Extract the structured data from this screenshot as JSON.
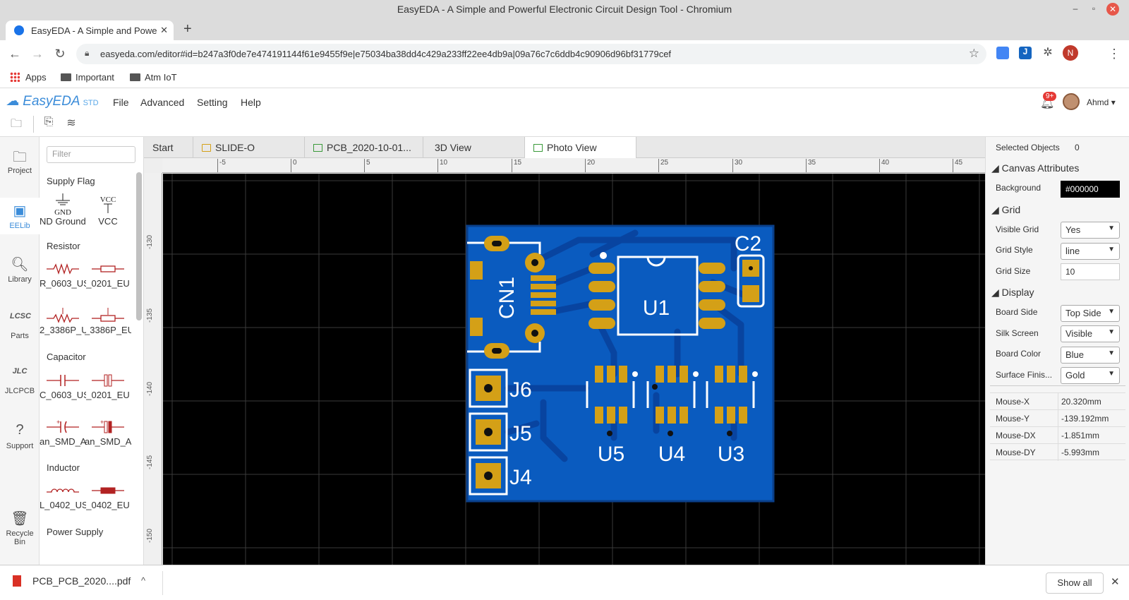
{
  "window": {
    "title": "EasyEDA - A Simple and Powerful Electronic Circuit Design Tool - Chromium"
  },
  "browser_tab": {
    "title": "EasyEDA - A Simple and Powe"
  },
  "address": {
    "url": "easyeda.com/editor#id=b247a3f0de7e474191144f61e9455f9e|e75034ba38dd4c429a233ff22ee4db9a|09a76c7c6ddb4c90906d96bf31779cef"
  },
  "profile_initial": "N",
  "bookmarks": [
    "Apps",
    "Important",
    "Atm IoT"
  ],
  "app": {
    "logo": "EasyEDA",
    "logo_suffix": "STD",
    "menu": [
      "File",
      "Advanced",
      "Setting",
      "Help"
    ],
    "notifications": "9+",
    "user": "Ahmd"
  },
  "leftbar": [
    "Project",
    "EELib",
    "Library",
    "Parts",
    "JLCPCB",
    "Support",
    "Recycle Bin"
  ],
  "library": {
    "filter_placeholder": "Filter",
    "categories": [
      "Supply Flag",
      "Resistor",
      "Capacitor",
      "Inductor",
      "Power Supply"
    ],
    "parts": {
      "gnd": "ND Ground(",
      "vcc": "VCC",
      "r1": "R_0603_US",
      "r2": "_0201_EU",
      "r3": "2_3386P_U",
      "r4": "_3386P_EU",
      "c1": "C_0603_US",
      "c2": "_0201_EU",
      "c3": "an_SMD_A",
      "c4": "an_SMD_A",
      "l1": "L_0402_US",
      "l2": "_0402_EU"
    },
    "symbol_text": {
      "gnd": "GND",
      "vcc": "VCC"
    }
  },
  "doc_tabs": [
    "Start",
    "SLIDE-O",
    "PCB_2020-10-01...",
    "3D View",
    "Photo View"
  ],
  "ruler": {
    "top": [
      "-5",
      "0",
      "5",
      "10",
      "15",
      "20",
      "25",
      "30",
      "35",
      "40",
      "45"
    ],
    "left": [
      "-130",
      "-135",
      "-140",
      "-145",
      "-150"
    ]
  },
  "pcb": {
    "labels": [
      "CN1",
      "U1",
      "C2",
      "J6",
      "J5",
      "J4",
      "U5",
      "U4",
      "U3"
    ],
    "board_color": "#0a5bbf",
    "copper_color": "#d4a017"
  },
  "right_panel": {
    "selected_label": "Selected Objects",
    "selected_count": "0",
    "canvas_title": "Canvas Attributes",
    "background_label": "Background",
    "background_value": "#000000",
    "grid_title": "Grid",
    "visible_grid_label": "Visible Grid",
    "visible_grid_value": "Yes",
    "grid_style_label": "Grid Style",
    "grid_style_value": "line",
    "grid_size_label": "Grid Size",
    "grid_size_value": "10",
    "display_title": "Display",
    "board_side_label": "Board Side",
    "board_side_value": "Top Side",
    "silk_label": "Silk Screen",
    "silk_value": "Visible",
    "board_color_label": "Board Color",
    "board_color_value": "Blue",
    "surface_label": "Surface Finis...",
    "surface_value": "Gold",
    "mouse": [
      {
        "k": "Mouse-X",
        "v": "20.320mm"
      },
      {
        "k": "Mouse-Y",
        "v": "-139.192mm"
      },
      {
        "k": "Mouse-DX",
        "v": "-1.851mm"
      },
      {
        "k": "Mouse-DY",
        "v": "-5.993mm"
      }
    ]
  },
  "download": {
    "file": "PCB_PCB_2020....pdf",
    "show_all": "Show all"
  }
}
